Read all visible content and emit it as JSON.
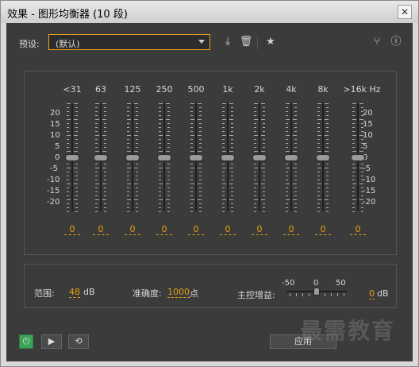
{
  "window": {
    "title": "效果 - 图形均衡器 (10 段)",
    "close_glyph": "✕"
  },
  "preset": {
    "label": "预设:",
    "value": "(默认)"
  },
  "toolbar": {
    "download_icon": "download-icon",
    "trash_icon": "trash-icon",
    "star_icon": "star-icon",
    "routing_icon": "routing-icon",
    "info_icon": "info-icon"
  },
  "eq": {
    "bands": [
      {
        "freq": "<31",
        "value": "0"
      },
      {
        "freq": "63",
        "value": "0"
      },
      {
        "freq": "125",
        "value": "0"
      },
      {
        "freq": "250",
        "value": "0"
      },
      {
        "freq": "500",
        "value": "0"
      },
      {
        "freq": "1k",
        "value": "0"
      },
      {
        "freq": "2k",
        "value": "0"
      },
      {
        "freq": "4k",
        "value": "0"
      },
      {
        "freq": "8k",
        "value": "0"
      },
      {
        "freq": ">16k Hz",
        "value": "0"
      }
    ],
    "scale": [
      "20",
      "15",
      "10",
      "5",
      "0",
      "-5",
      "-10",
      "-15",
      "-20"
    ]
  },
  "settings": {
    "range_label": "范围:",
    "range_value": "48",
    "range_unit": "dB",
    "accuracy_label": "准确度:",
    "accuracy_value": "1000",
    "accuracy_unit": "点",
    "master_label": "主控增益:",
    "master_scale": [
      "-50",
      "0",
      "50"
    ],
    "master_value": "0",
    "master_unit": "dB"
  },
  "bottom": {
    "power_icon": "power-icon",
    "play_icon": "play-icon",
    "loop_icon": "loop-icon",
    "apply_label": "应用"
  },
  "watermark": "最需教育",
  "colors": {
    "accent": "#e2a012",
    "panel": "#3b3b3b",
    "power": "#3aa356"
  }
}
